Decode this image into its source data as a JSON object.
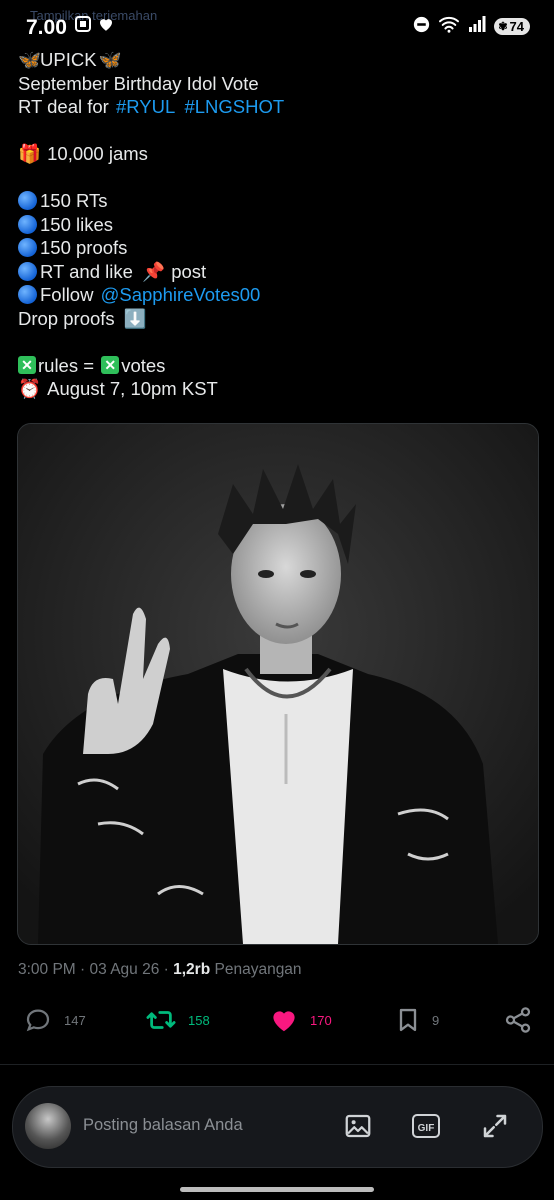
{
  "status_bar": {
    "time": "7.00",
    "translate_hint": "Tampilkan terjemahan",
    "battery": "74"
  },
  "tweet": {
    "lines": {
      "l1": "UPICK",
      "l2": "September Birthday Idol Vote",
      "l3_prefix": "RT deal for ",
      "l3_tag1": "#RYUL",
      "l3_tag2": "#LNGSHOT",
      "l4": "10,000 jams",
      "l5": "150 RTs",
      "l6": "150 likes",
      "l7": "150 proofs",
      "l8_a": "RT and like",
      "l8_b": "post",
      "l9_prefix": "Follow ",
      "l9_handle": "@SapphireVotes00",
      "l10": "Drop proofs",
      "l11_a": "rules = ",
      "l11_b": "votes",
      "l12": "August 7, 10pm KST"
    },
    "emojis": {
      "butterfly": "🦋",
      "gift": "🎁",
      "pin": "📌",
      "down_arrow": "⬇️",
      "alarm": "⏰",
      "cross": "✕"
    },
    "meta": {
      "time": "3:00 PM",
      "date": "03 Agu 26",
      "views_count": "1,2rb",
      "views_label": "Penayangan"
    },
    "actions": {
      "replies": "147",
      "retweets": "158",
      "likes": "170",
      "bookmarks": "9"
    }
  },
  "reply_bar": {
    "placeholder": "Posting balasan Anda",
    "gif_label": "GIF"
  },
  "colors": {
    "background": "#000000",
    "link": "#1d9bf0",
    "retweet": "#00ba7c",
    "like": "#f91880",
    "muted": "#71767b"
  }
}
